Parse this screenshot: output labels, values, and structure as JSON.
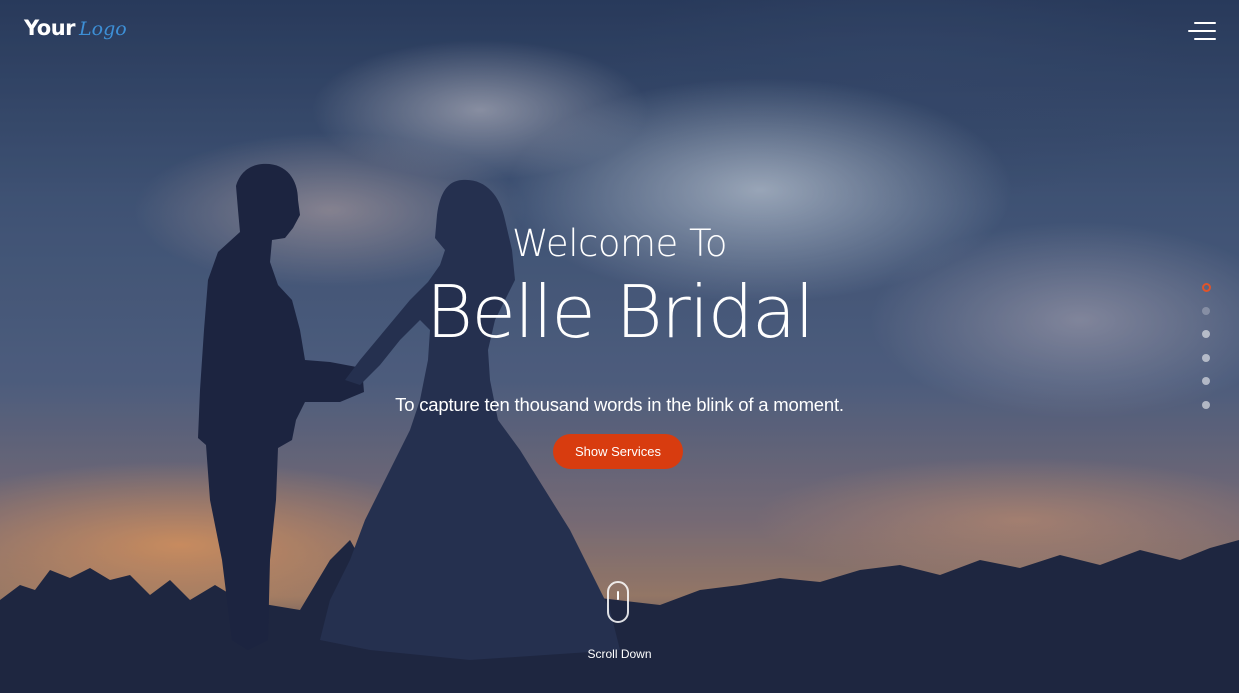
{
  "header": {
    "logo_part1": "Your",
    "logo_part2": "Logo",
    "menu_icon": "hamburger-menu-icon"
  },
  "hero": {
    "welcome": "Welcome To",
    "title": "Belle Bridal",
    "tagline": "To capture ten thousand words in the blink of a moment.",
    "cta_label": "Show Services",
    "scroll_label": "Scroll Down",
    "scroll_icon": "mouse-scroll-icon"
  },
  "section_nav": {
    "count": 6,
    "active_index": 0
  },
  "colors": {
    "accent": "#d83c0f",
    "logo_blue": "#3d8fd6",
    "text": "#ffffff"
  }
}
